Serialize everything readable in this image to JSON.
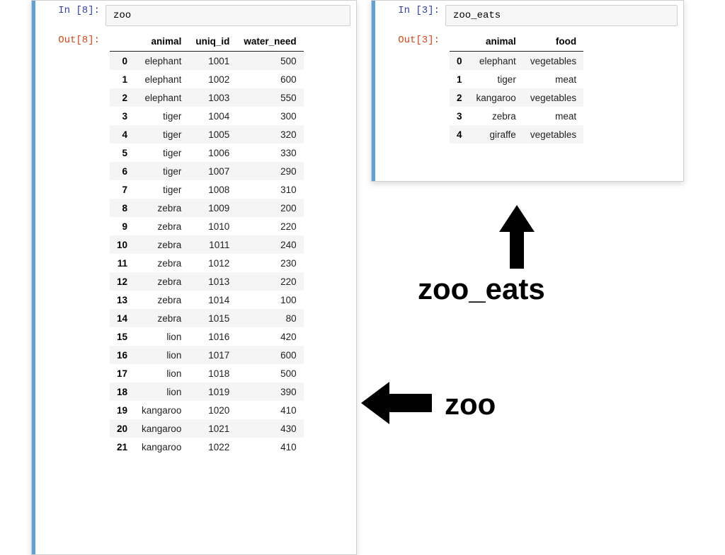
{
  "left": {
    "in_prompt": "In [8]:",
    "out_prompt": "Out[8]:",
    "code": "zoo",
    "columns": [
      "animal",
      "uniq_id",
      "water_need"
    ],
    "rows": [
      {
        "idx": "0",
        "animal": "elephant",
        "uniq_id": "1001",
        "water_need": "500"
      },
      {
        "idx": "1",
        "animal": "elephant",
        "uniq_id": "1002",
        "water_need": "600"
      },
      {
        "idx": "2",
        "animal": "elephant",
        "uniq_id": "1003",
        "water_need": "550"
      },
      {
        "idx": "3",
        "animal": "tiger",
        "uniq_id": "1004",
        "water_need": "300"
      },
      {
        "idx": "4",
        "animal": "tiger",
        "uniq_id": "1005",
        "water_need": "320"
      },
      {
        "idx": "5",
        "animal": "tiger",
        "uniq_id": "1006",
        "water_need": "330"
      },
      {
        "idx": "6",
        "animal": "tiger",
        "uniq_id": "1007",
        "water_need": "290"
      },
      {
        "idx": "7",
        "animal": "tiger",
        "uniq_id": "1008",
        "water_need": "310"
      },
      {
        "idx": "8",
        "animal": "zebra",
        "uniq_id": "1009",
        "water_need": "200"
      },
      {
        "idx": "9",
        "animal": "zebra",
        "uniq_id": "1010",
        "water_need": "220"
      },
      {
        "idx": "10",
        "animal": "zebra",
        "uniq_id": "1011",
        "water_need": "240"
      },
      {
        "idx": "11",
        "animal": "zebra",
        "uniq_id": "1012",
        "water_need": "230"
      },
      {
        "idx": "12",
        "animal": "zebra",
        "uniq_id": "1013",
        "water_need": "220"
      },
      {
        "idx": "13",
        "animal": "zebra",
        "uniq_id": "1014",
        "water_need": "100"
      },
      {
        "idx": "14",
        "animal": "zebra",
        "uniq_id": "1015",
        "water_need": "80"
      },
      {
        "idx": "15",
        "animal": "lion",
        "uniq_id": "1016",
        "water_need": "420"
      },
      {
        "idx": "16",
        "animal": "lion",
        "uniq_id": "1017",
        "water_need": "600"
      },
      {
        "idx": "17",
        "animal": "lion",
        "uniq_id": "1018",
        "water_need": "500"
      },
      {
        "idx": "18",
        "animal": "lion",
        "uniq_id": "1019",
        "water_need": "390"
      },
      {
        "idx": "19",
        "animal": "kangaroo",
        "uniq_id": "1020",
        "water_need": "410"
      },
      {
        "idx": "20",
        "animal": "kangaroo",
        "uniq_id": "1021",
        "water_need": "430"
      },
      {
        "idx": "21",
        "animal": "kangaroo",
        "uniq_id": "1022",
        "water_need": "410"
      }
    ]
  },
  "right": {
    "in_prompt": "In [3]:",
    "out_prompt": "Out[3]:",
    "code": "zoo_eats",
    "columns": [
      "animal",
      "food"
    ],
    "rows": [
      {
        "idx": "0",
        "animal": "elephant",
        "food": "vegetables"
      },
      {
        "idx": "1",
        "animal": "tiger",
        "food": "meat"
      },
      {
        "idx": "2",
        "animal": "kangaroo",
        "food": "vegetables"
      },
      {
        "idx": "3",
        "animal": "zebra",
        "food": "meat"
      },
      {
        "idx": "4",
        "animal": "giraffe",
        "food": "vegetables"
      }
    ]
  },
  "annotations": {
    "zoo_eats": "zoo_eats",
    "zoo": "zoo"
  }
}
